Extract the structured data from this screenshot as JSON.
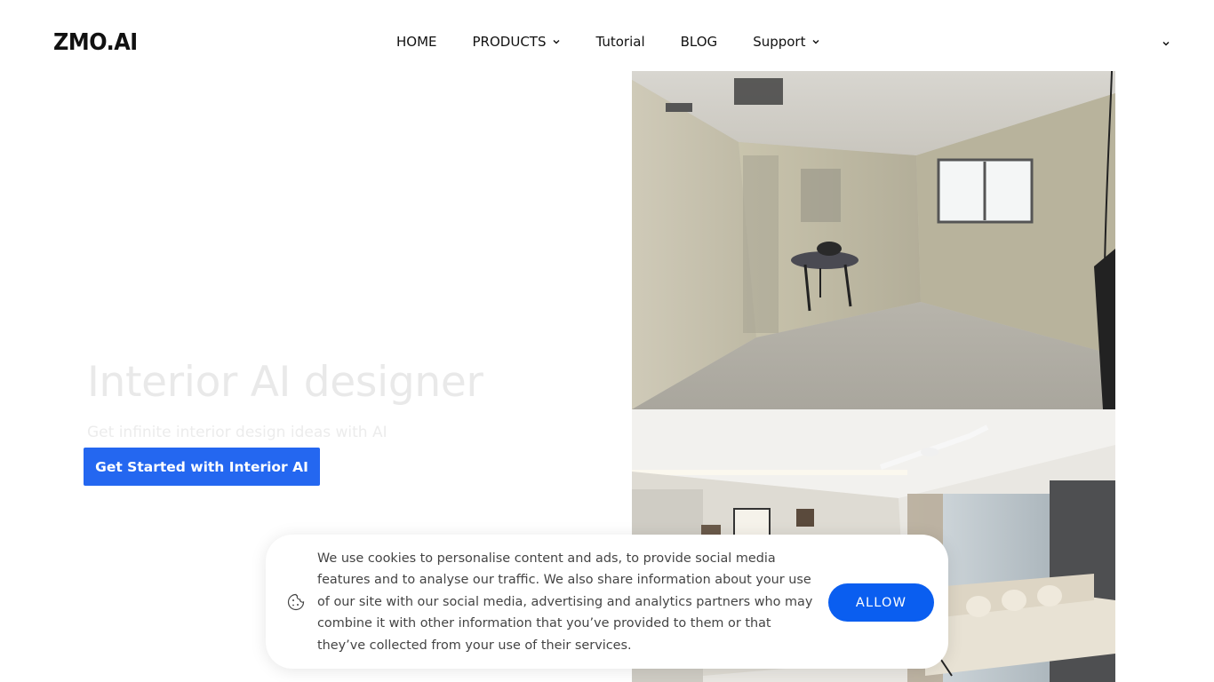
{
  "header": {
    "logo": "ZMO.AI",
    "nav": [
      {
        "label": "HOME",
        "dropdown": false
      },
      {
        "label": "PRODUCTS",
        "dropdown": true
      },
      {
        "label": "Tutorial",
        "dropdown": false
      },
      {
        "label": "BLOG",
        "dropdown": false
      },
      {
        "label": "Support",
        "dropdown": true
      }
    ],
    "language_dropdown_icon": "chevron-down-icon"
  },
  "hero": {
    "title": "Interior AI designer",
    "subtitle": "Get infinite interior design ideas with AI",
    "cta_label": "Get Started with Interior AI",
    "cta_color": "#2467f0"
  },
  "images": [
    {
      "name": "before-image",
      "description_icon": "unfinished-room-photo"
    },
    {
      "name": "after-image",
      "description_icon": "designed-living-room-photo"
    }
  ],
  "cookie_banner": {
    "icon": "cookie-icon",
    "text": "We use cookies to personalise content and ads, to provide social media features and to analyse our traffic. We also share information about your use of our site with our social media, advertising and analytics partners who may combine it with other information that you’ve provided to them or that they’ve collected from your use of their services.",
    "allow_label": "ALLOW",
    "allow_color": "#0a5ef0"
  }
}
